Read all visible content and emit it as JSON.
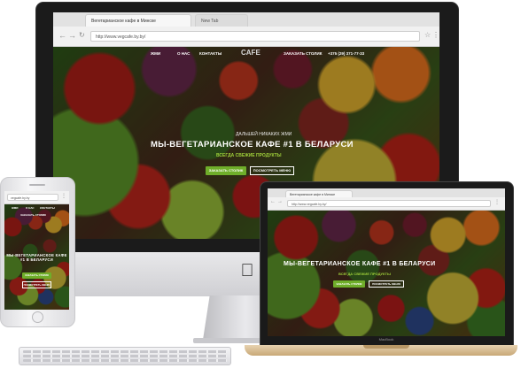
{
  "imac": {
    "tab_active": "Вегетарианское кафе в Минске",
    "tab_inactive": "New Tab",
    "url": "http://www.vegcafe.by.by/",
    "nav": [
      "ЖМИ",
      "О НАС",
      "КОНТАКТЫ",
      "ЗАКАЗАТЬ СТОЛИК",
      "+375 (29) 371-77-33"
    ],
    "logo": "CAFE",
    "hero_sub": "ДАЛЬШЕЙ НИКАКИХ ЖМИ",
    "hero_title": "МЫ-ВЕГЕТАРИАНСКОЕ КАФЕ #1 В БЕЛАРУСИ",
    "hero_tag": "ВСЕГДА СВЕЖИЕ ПРОДУКТЫ",
    "btn_primary": "ЗАКАЗАТЬ СТОЛИК",
    "btn_secondary": "ПОСМОТРЕТЬ МЕНЮ"
  },
  "laptop": {
    "tab_active": "Вегетарианское кафе в Минске",
    "url": "http://www.vegcafe.by.by/",
    "hero_title": "МЫ-ВЕГЕТАРИАНСКОЕ КАФЕ #1 В БЕЛАРУСИ",
    "hero_tag": "ВСЕГДА СВЕЖИЕ ПРОДУКТЫ",
    "btn_primary": "ЗАКАЗАТЬ СТОЛИК",
    "btn_secondary": "ПОСМОТРЕТЬ МЕНЮ",
    "brand": "MacBook"
  },
  "phone": {
    "url": "vegcafe.by.by",
    "nav": [
      "ЖМИ",
      "О НАС",
      "КОНТАКТЫ"
    ],
    "nav_cta": "ЗАКАЗАТЬ СТОЛИК",
    "hero_title": "МЫ-ВЕГЕТАРИАНСКОЕ КАФЕ #1 В БЕЛАРУСИ",
    "btn_primary": "ЗАКАЗАТЬ СТОЛИК",
    "btn_secondary": "ПОСМОТРЕТЬ МЕНЮ"
  },
  "colors": {
    "accent_green": "#6fae2a",
    "tag_green": "#9fd03a"
  },
  "icons": [
    "back-arrow-icon",
    "forward-arrow-icon",
    "reload-icon",
    "star-icon",
    "menu-icon",
    "apple-logo-icon"
  ]
}
